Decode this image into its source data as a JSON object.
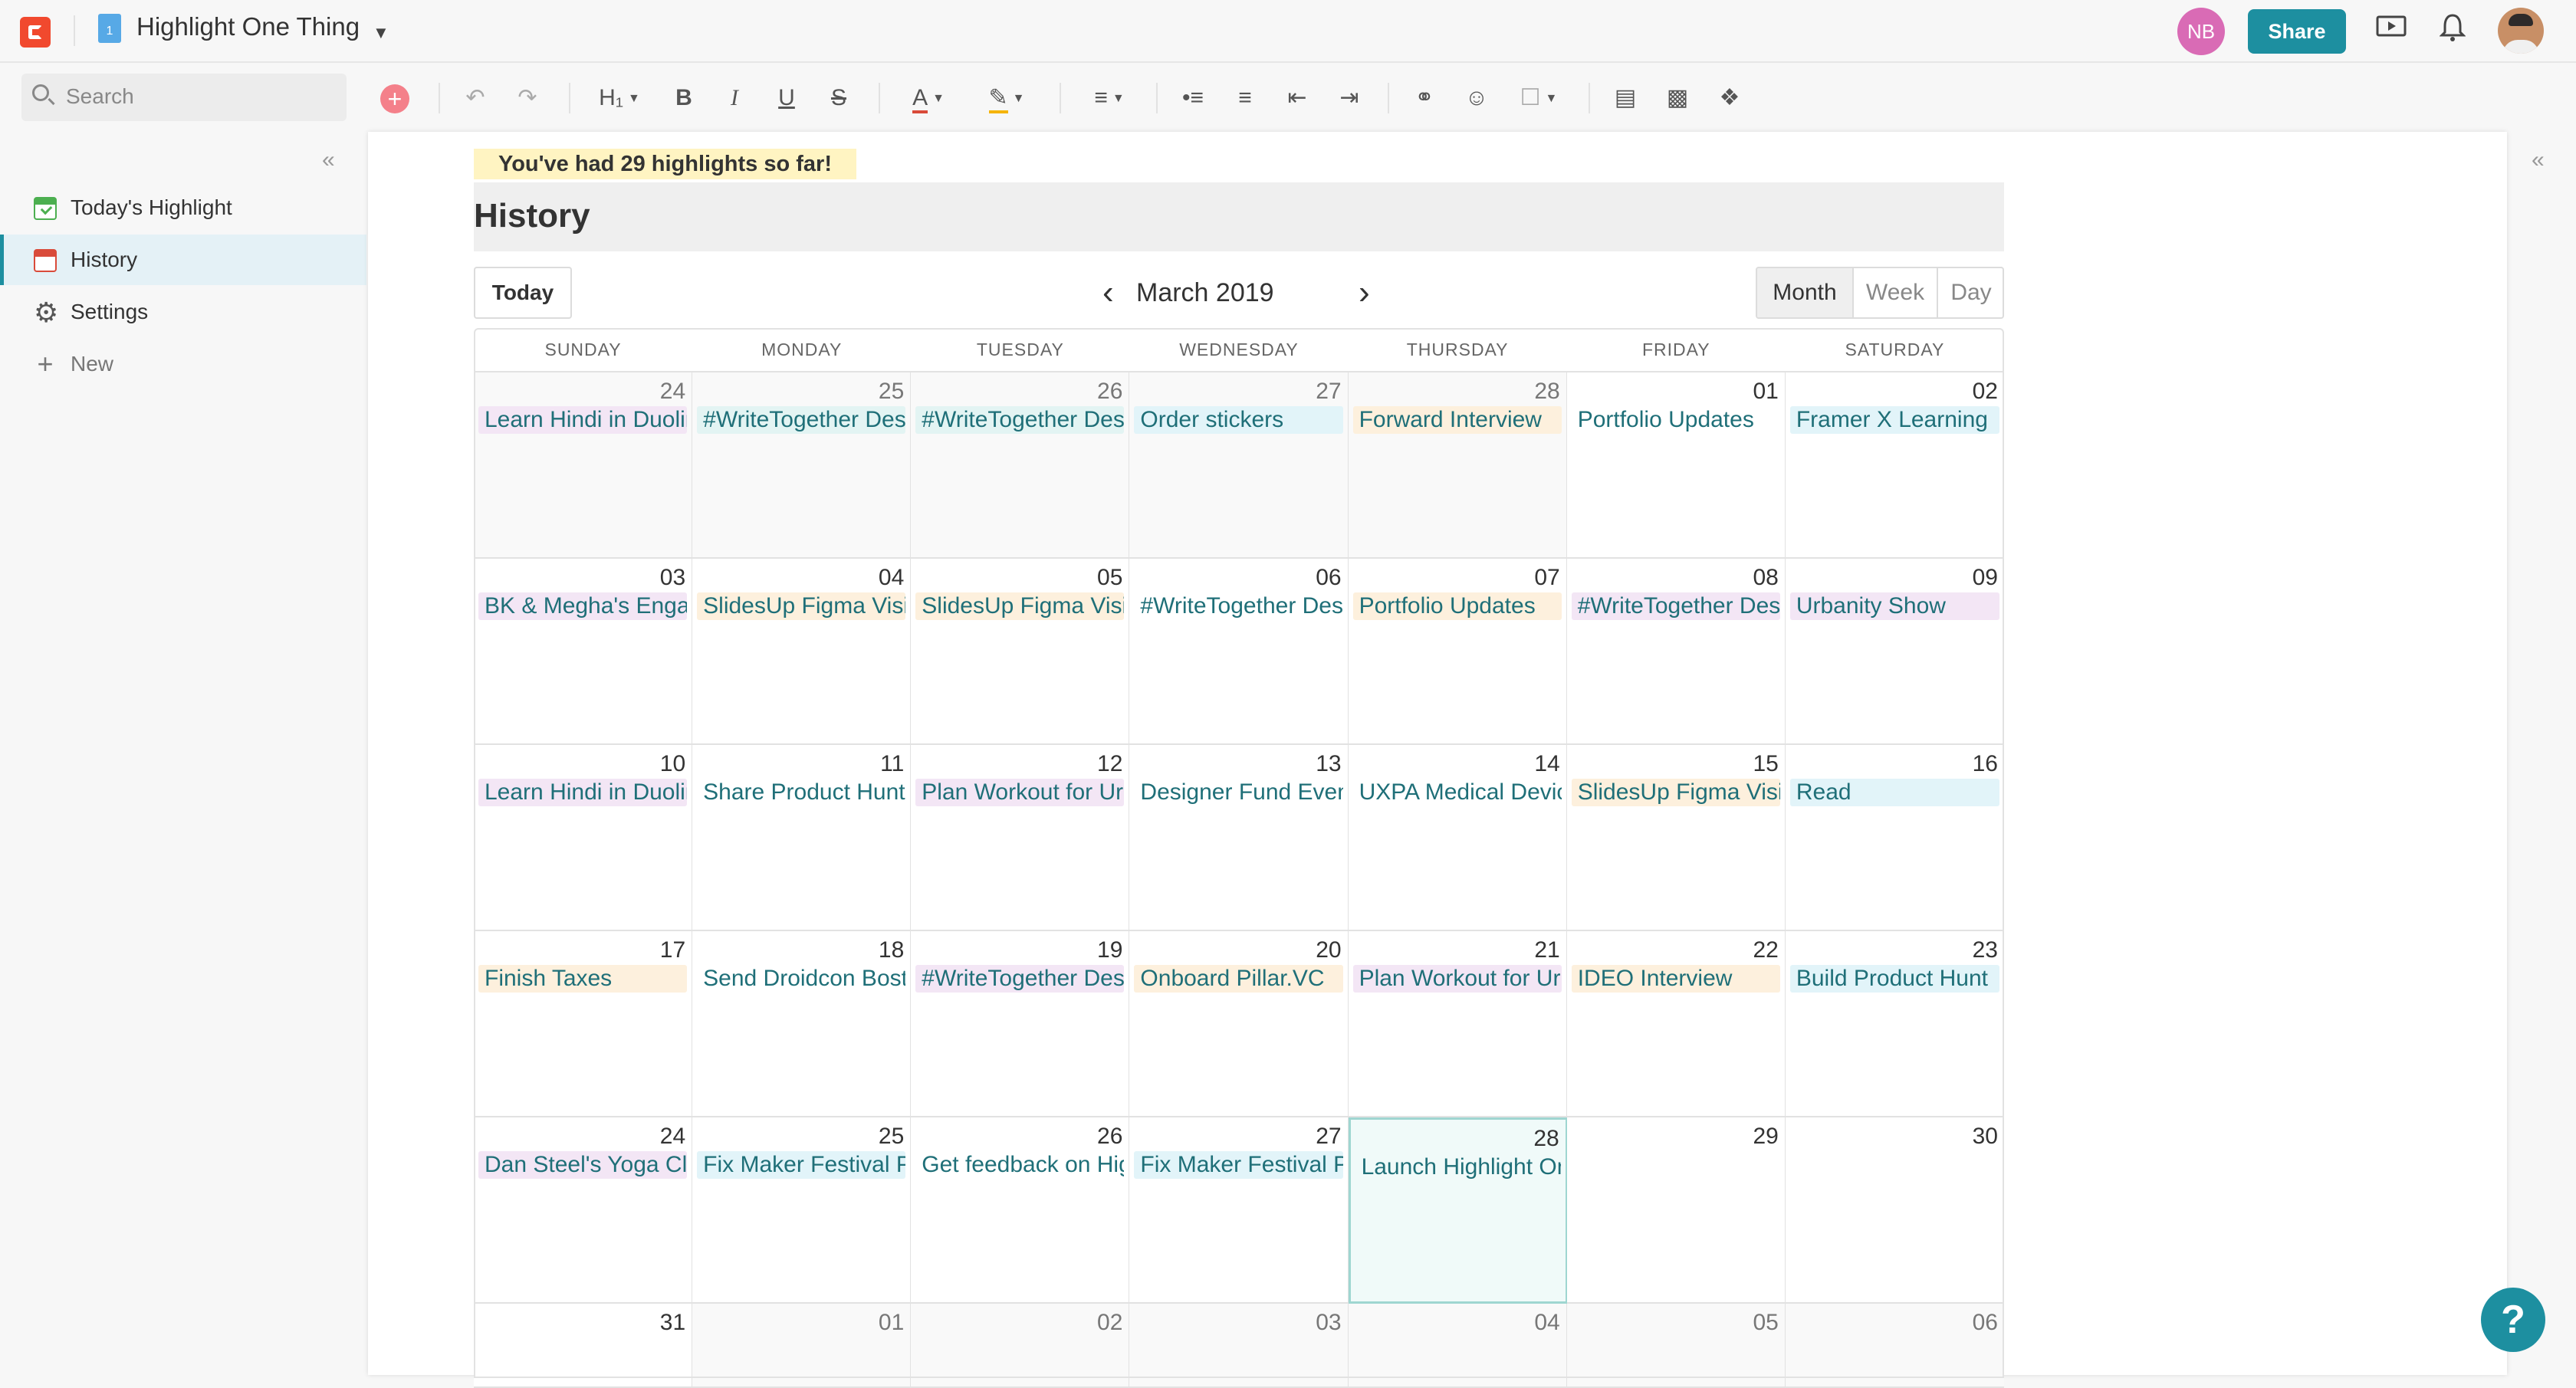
{
  "app": {
    "doc_title": "Highlight One Thing",
    "doc_icon_label": "1",
    "avatar_initials": "NB",
    "share_label": "Share",
    "accent_color": "#1d8fa0"
  },
  "search": {
    "placeholder": "Search"
  },
  "toolbar": {
    "heading_label": "H₁",
    "bold": "B",
    "italic": "I",
    "underline": "U",
    "strike": "S",
    "text_color_glyph": "A"
  },
  "sidebar": {
    "items": [
      {
        "label": "Today's Highlight",
        "icon": "calendar-check-icon"
      },
      {
        "label": "History",
        "icon": "calendar-icon",
        "active": true
      },
      {
        "label": "Settings",
        "icon": "gear-icon"
      },
      {
        "label": "New",
        "icon": "plus-icon"
      }
    ]
  },
  "page": {
    "banner": "You've had 29 highlights so far!",
    "title": "History"
  },
  "calendar": {
    "today_label": "Today",
    "month_label": "March 2019",
    "views": [
      "Month",
      "Week",
      "Day"
    ],
    "active_view": "Month",
    "weekdays": [
      "SUNDAY",
      "MONDAY",
      "TUESDAY",
      "WEDNESDAY",
      "THURSDAY",
      "FRIDAY",
      "SATURDAY"
    ],
    "weeks": [
      [
        {
          "day": "24",
          "other": true,
          "event": "Learn Hindi in Duolingo",
          "color": "purple"
        },
        {
          "day": "25",
          "other": true,
          "event": "#WriteTogether Design",
          "color": "teal"
        },
        {
          "day": "26",
          "other": true,
          "event": "#WriteTogether Design",
          "color": "teal"
        },
        {
          "day": "27",
          "other": true,
          "event": "Order stickers",
          "color": "blue"
        },
        {
          "day": "28",
          "other": true,
          "event": "Forward Interview",
          "color": "orange"
        },
        {
          "day": "01",
          "event": "Portfolio Updates",
          "color": "none"
        },
        {
          "day": "02",
          "event": "Framer X Learning",
          "color": "blue"
        }
      ],
      [
        {
          "day": "03",
          "event": "BK & Megha's Engagement",
          "color": "purple"
        },
        {
          "day": "04",
          "event": "SlidesUp Figma Visit",
          "color": "orange"
        },
        {
          "day": "05",
          "event": "SlidesUp Figma Visit",
          "color": "orange"
        },
        {
          "day": "06",
          "event": "#WriteTogether Design",
          "color": "none"
        },
        {
          "day": "07",
          "event": "Portfolio Updates",
          "color": "orange"
        },
        {
          "day": "08",
          "event": "#WriteTogether Design",
          "color": "purple"
        },
        {
          "day": "09",
          "event": "Urbanity Show",
          "color": "purple"
        }
      ],
      [
        {
          "day": "10",
          "event": "Learn Hindi in Duolingo",
          "color": "purple"
        },
        {
          "day": "11",
          "event": "Share Product Hunt",
          "color": "none"
        },
        {
          "day": "12",
          "event": "Plan Workout for Urban",
          "color": "purple"
        },
        {
          "day": "13",
          "event": "Designer Fund Event",
          "color": "none"
        },
        {
          "day": "14",
          "event": "UXPA Medical Device",
          "color": "none"
        },
        {
          "day": "15",
          "event": "SlidesUp Figma Visit",
          "color": "orange"
        },
        {
          "day": "16",
          "event": "Read",
          "color": "blue"
        }
      ],
      [
        {
          "day": "17",
          "event": "Finish Taxes",
          "color": "orange"
        },
        {
          "day": "18",
          "event": "Send Droidcon Boston",
          "color": "none"
        },
        {
          "day": "19",
          "event": "#WriteTogether Design",
          "color": "purple"
        },
        {
          "day": "20",
          "event": "Onboard Pillar.VC",
          "color": "orange"
        },
        {
          "day": "21",
          "event": "Plan Workout for Urban",
          "color": "purple"
        },
        {
          "day": "22",
          "event": "IDEO Interview",
          "color": "orange"
        },
        {
          "day": "23",
          "event": "Build Product Hunt",
          "color": "blue"
        }
      ],
      [
        {
          "day": "24",
          "event": "Dan Steel's Yoga Class",
          "color": "purple"
        },
        {
          "day": "25",
          "event": "Fix Maker Festival Page",
          "color": "blue"
        },
        {
          "day": "26",
          "event": "Get feedback on Highlight",
          "color": "none"
        },
        {
          "day": "27",
          "event": "Fix Maker Festival Page",
          "color": "blue"
        },
        {
          "day": "28",
          "event": "Launch Highlight One Thing",
          "color": "none",
          "today": true
        },
        {
          "day": "29",
          "event": ""
        },
        {
          "day": "30",
          "event": ""
        }
      ],
      [
        {
          "day": "31",
          "event": ""
        },
        {
          "day": "01",
          "other": true,
          "event": ""
        },
        {
          "day": "02",
          "other": true,
          "event": ""
        },
        {
          "day": "03",
          "other": true,
          "event": ""
        },
        {
          "day": "04",
          "other": true,
          "event": ""
        },
        {
          "day": "05",
          "other": true,
          "event": ""
        },
        {
          "day": "06",
          "other": true,
          "event": ""
        }
      ]
    ],
    "event_colors": {
      "purple": "#f3e6f5",
      "teal": "#e3f4f3",
      "blue": "#e2f4f9",
      "orange": "#fdf0dd",
      "none": "transparent"
    },
    "event_text_color": "#1f6f78"
  },
  "help": {
    "label": "?"
  }
}
